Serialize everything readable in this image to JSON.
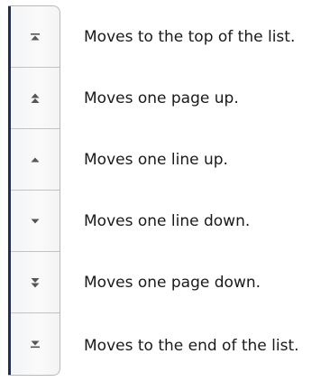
{
  "nav_strip": {
    "accent_color": "#1f2f5a",
    "buttons": [
      {
        "icon": "first-page-icon",
        "description": "Moves to the top of the list."
      },
      {
        "icon": "page-up-icon",
        "description": "Moves one page up."
      },
      {
        "icon": "line-up-icon",
        "description": "Moves one line up."
      },
      {
        "icon": "line-down-icon",
        "description": "Moves one line down."
      },
      {
        "icon": "page-down-icon",
        "description": "Moves one page down."
      },
      {
        "icon": "last-page-icon",
        "description": "Moves to the end of the list."
      }
    ]
  }
}
